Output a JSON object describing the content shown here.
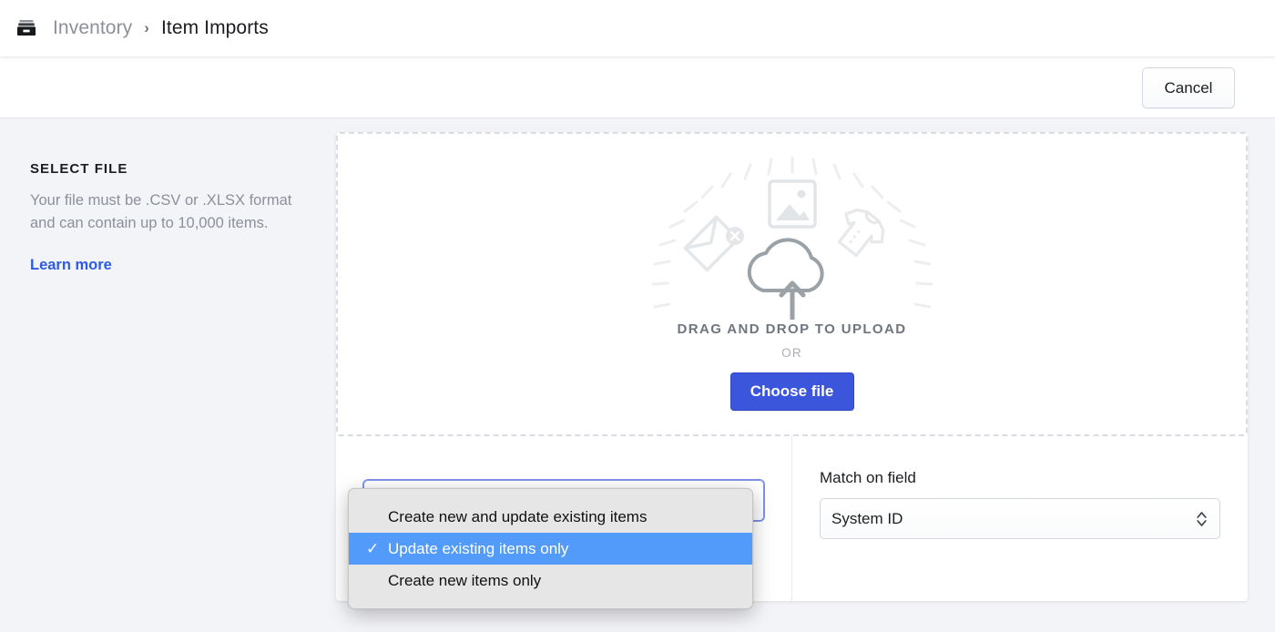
{
  "breadcrumb": {
    "icon": "inventory-box-icon",
    "parent": "Inventory",
    "separator": "›",
    "current": "Item Imports"
  },
  "actionbar": {
    "cancel_label": "Cancel"
  },
  "info": {
    "title": "SELECT FILE",
    "description": "Your file must be .CSV or .XLSX format and can contain up to 10,000 items.",
    "link_label": "Learn more"
  },
  "dropzone": {
    "art_icons": [
      "image-icon",
      "tag-icon",
      "tshirt-icon",
      "cloud-upload-icon"
    ],
    "drag_label": "DRAG AND DROP TO UPLOAD",
    "or_label": "OR",
    "choose_button": "Choose file"
  },
  "options": {
    "import_mode": {
      "label": "",
      "value": "Update existing items only",
      "focused": true
    },
    "match_field": {
      "label": "Match on field",
      "value": "System ID"
    }
  },
  "popup_menu": {
    "checkmark": "✓",
    "items": [
      {
        "label": "Create new and update existing items",
        "selected": false
      },
      {
        "label": "Update existing items only",
        "selected": true
      },
      {
        "label": "Create new items only",
        "selected": false
      }
    ]
  },
  "colors": {
    "accent_blue": "#3b55db",
    "link_blue": "#2d5be3",
    "selection_blue": "#539bfa",
    "page_bg": "#f3f4f8",
    "muted_text": "#8b9099"
  }
}
